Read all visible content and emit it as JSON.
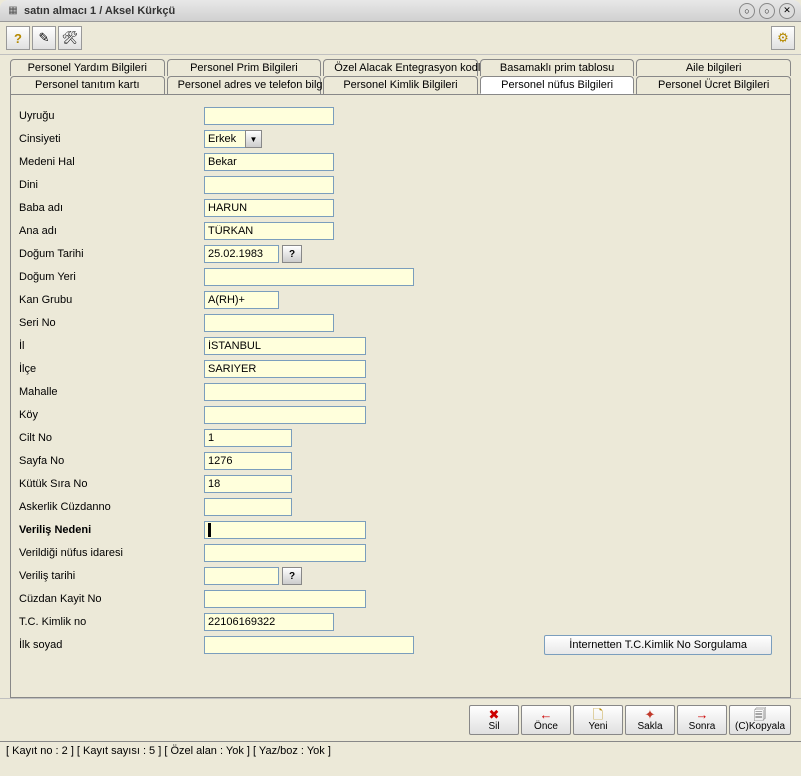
{
  "window": {
    "title": "satın almacı 1 / Aksel Kürkçü"
  },
  "tabsRow1": {
    "t0": "Personel Yardım Bilgileri",
    "t1": "Personel Prim Bilgileri",
    "t2": "Özel Alacak Entegrasyon kodları",
    "t3": "Basamaklı prim tablosu",
    "t4": "Aile bilgileri"
  },
  "tabsRow2": {
    "t0": "Personel tanıtım kartı",
    "t1": "Personel adres ve telefon bilgileri",
    "t2": "Personel Kimlik Bilgileri",
    "t3": "Personel nüfus Bilgileri",
    "t4": "Personel Ücret Bilgileri"
  },
  "labels": {
    "uyrugu": "Uyruğu",
    "cinsiyeti": "Cinsiyeti",
    "medenihal": "Medeni Hal",
    "dini": "Dini",
    "babaadi": "Baba adı",
    "anaadi": "Ana adı",
    "dogumtarihi": "Doğum Tarihi",
    "dogumyeri": "Doğum Yeri",
    "kangrubu": "Kan Grubu",
    "serino": "Seri No",
    "il": "İl",
    "ilce": "İlçe",
    "mahalle": "Mahalle",
    "koy": "Köy",
    "ciltno": "Cilt No",
    "sayfano": "Sayfa No",
    "kutuksirano": "Kütük Sıra No",
    "askerlikcuzdanno": "Askerlik Cüzdanno",
    "verilisnedeni": "Veriliş Nedeni",
    "verildiginufusidaresi": "Verildiği nüfus idaresi",
    "verilistarihi": "Veriliş tarihi",
    "cuzdankayitno": "Cüzdan Kayit No",
    "tckimlikno": "T.C. Kimlik no",
    "ilksoyad": "İlk soyad"
  },
  "values": {
    "uyrugu": "",
    "cinsiyeti": "Erkek",
    "medenihal": "Bekar",
    "dini": "",
    "babaadi": "HARUN",
    "anaadi": "TÜRKAN",
    "dogumtarihi": "25.02.1983",
    "dogumyeri": "",
    "kangrubu": "A(RH)+",
    "serino": "",
    "il": "İSTANBUL",
    "ilce": "SARIYER",
    "mahalle": "",
    "koy": "",
    "ciltno": "1",
    "sayfano": "1276",
    "kutuksirano": "18",
    "askerlikcuzdanno": "",
    "verilisnedeni": "",
    "verildiginufusidaresi": "",
    "verilistarihi": "",
    "cuzdankayitno": "",
    "tckimlikno": "22106169322",
    "ilksoyad": ""
  },
  "buttons": {
    "internetten": "İnternetten T.C.Kimlik No Sorgulama",
    "sil": "Sil",
    "once": "Önce",
    "yeni": "Yeni",
    "sakla": "Sakla",
    "sonra": "Sonra",
    "kopyala": "(C)Kopyala"
  },
  "status": "[ Kayıt no : 2 ] [ Kayıt sayısı : 5 ] [ Özel alan : Yok ] [ Yaz/boz : Yok ]"
}
